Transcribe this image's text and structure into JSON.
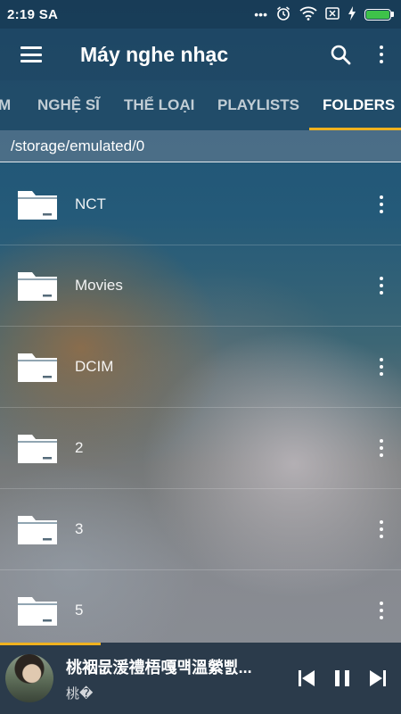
{
  "status_bar": {
    "time": "2:19 SA",
    "notification_dots": "•••",
    "icons": [
      "alarm-icon",
      "wifi-icon",
      "sim-off-icon",
      "charging-icon",
      "battery-icon"
    ],
    "battery_color": "#3ec24a"
  },
  "app_bar": {
    "title": "Máy nghe nhạc",
    "icons": [
      "menu-icon",
      "search-icon",
      "more-vert-icon"
    ]
  },
  "tabs": {
    "items": [
      {
        "label": "M"
      },
      {
        "label": "NGHỆ SĨ"
      },
      {
        "label": "THỂ LOẠI"
      },
      {
        "label": "PLAYLISTS"
      },
      {
        "label": "FOLDERS",
        "active": true
      }
    ],
    "indicator_color": "#f0b21f"
  },
  "path": "/storage/emulated/0",
  "folders": [
    {
      "name": "NCT"
    },
    {
      "name": "Movies"
    },
    {
      "name": "DCIM"
    },
    {
      "name": "2"
    },
    {
      "name": "3"
    },
    {
      "name": "5"
    }
  ],
  "player": {
    "title": "桃裀뭆湲禮梧嘎먝溫縈삜...",
    "artist": "桃�",
    "progress": 0.25,
    "icons": [
      "skip-previous-icon",
      "pause-icon",
      "skip-next-icon"
    ],
    "accent_color": "#f0b21f",
    "background_color": "#2b3b4b"
  }
}
